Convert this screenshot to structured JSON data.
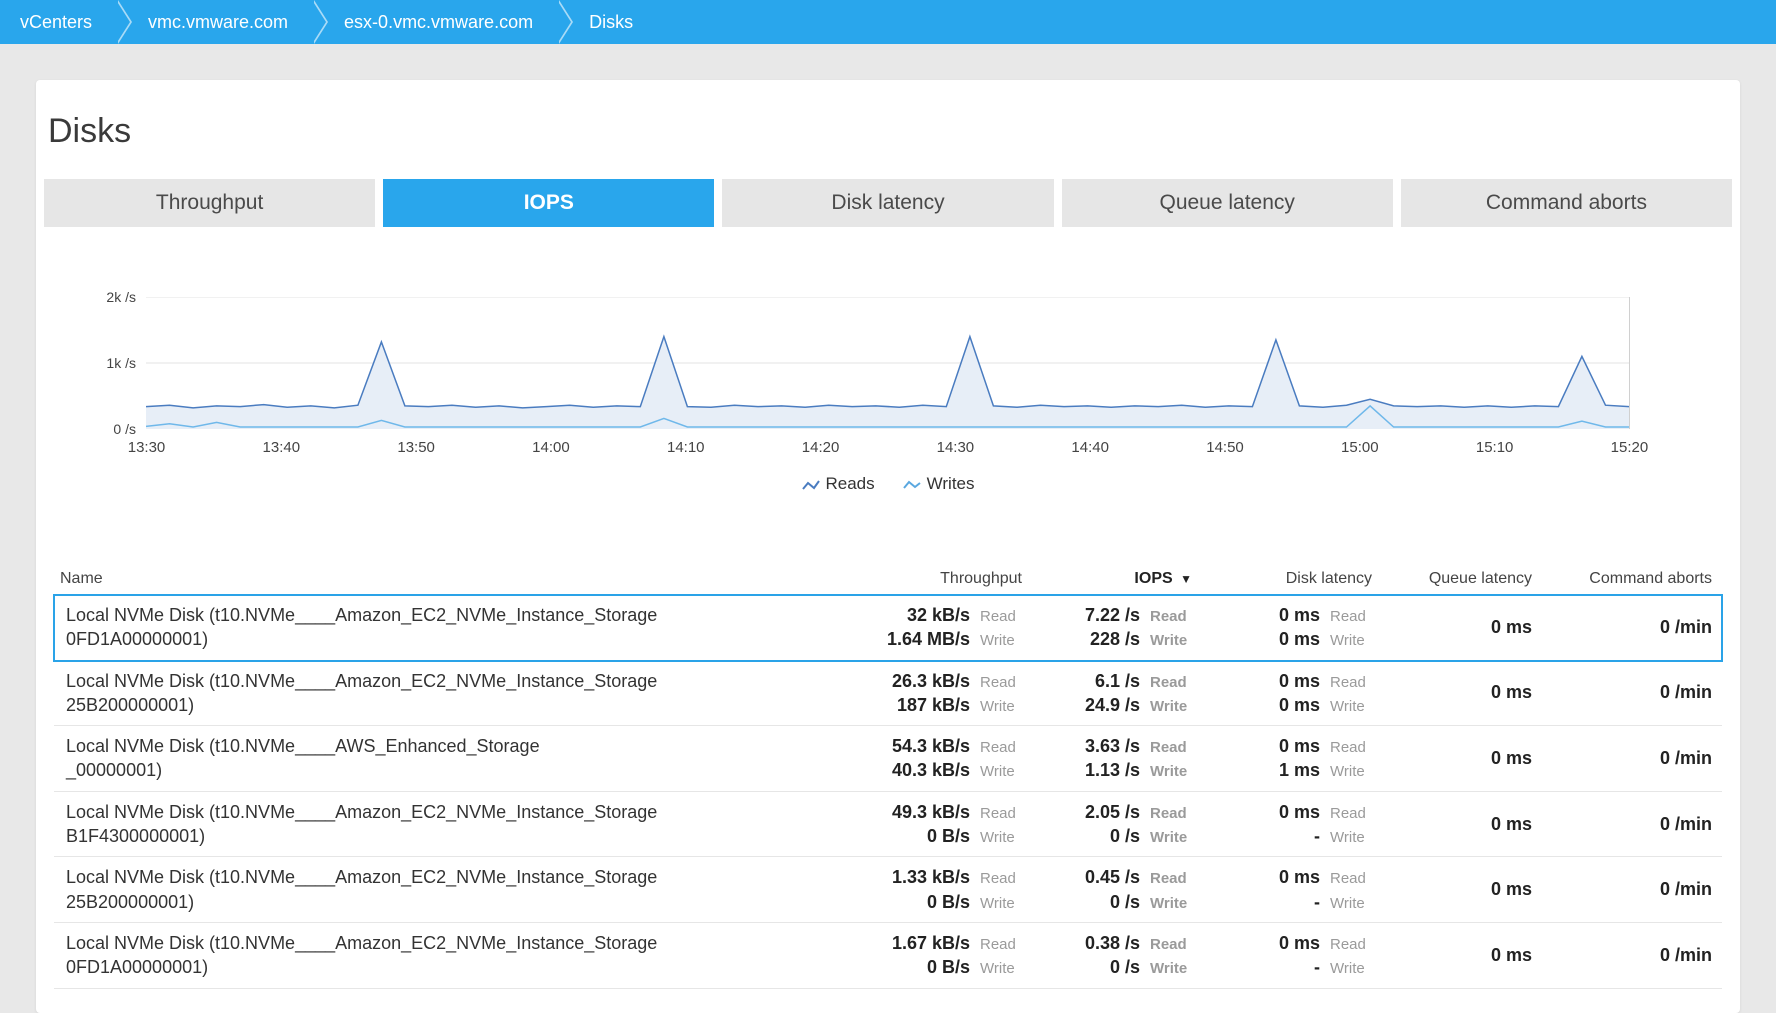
{
  "breadcrumb": [
    "vCenters",
    "vmc.vmware.com",
    "esx-0.vmc.vmware.com",
    "Disks"
  ],
  "page_title": "Disks",
  "tabs": [
    {
      "label": "Throughput",
      "active": false
    },
    {
      "label": "IOPS",
      "active": true
    },
    {
      "label": "Disk latency",
      "active": false
    },
    {
      "label": "Queue latency",
      "active": false
    },
    {
      "label": "Command aborts",
      "active": false
    }
  ],
  "legend": {
    "reads": "Reads",
    "writes": "Writes"
  },
  "chart_data": {
    "type": "area",
    "ylabel": "",
    "y_ticks": [
      "2k /s",
      "1k /s",
      "0 /s"
    ],
    "x_ticks": [
      "13:30",
      "13:40",
      "13:50",
      "14:00",
      "14:10",
      "14:20",
      "14:30",
      "14:40",
      "14:50",
      "15:00",
      "15:10",
      "15:20"
    ],
    "ylim": [
      0,
      2000
    ],
    "series": [
      {
        "name": "Reads",
        "x": [
          "13:22",
          "13:24",
          "13:26",
          "13:28",
          "13:30",
          "13:32",
          "13:34",
          "13:36",
          "13:38",
          "13:40",
          "13:42",
          "13:44",
          "13:46",
          "13:48",
          "13:50",
          "13:52",
          "13:54",
          "13:56",
          "13:58",
          "14:00",
          "14:02",
          "14:04",
          "14:05",
          "14:06",
          "14:08",
          "14:10",
          "14:12",
          "14:14",
          "14:16",
          "14:18",
          "14:20",
          "14:22",
          "14:24",
          "14:26",
          "14:28",
          "14:29",
          "14:30",
          "14:32",
          "14:34",
          "14:36",
          "14:38",
          "14:40",
          "14:42",
          "14:44",
          "14:46",
          "14:48",
          "14:50",
          "14:52",
          "14:53",
          "14:54",
          "14:56",
          "14:58",
          "15:00",
          "15:02",
          "15:04",
          "15:06",
          "15:08",
          "15:10",
          "15:12",
          "15:14",
          "15:15",
          "15:16",
          "15:18",
          "15:20"
        ],
        "values": [
          340,
          360,
          320,
          350,
          340,
          370,
          330,
          350,
          320,
          360,
          1320,
          350,
          340,
          360,
          330,
          350,
          320,
          340,
          360,
          330,
          350,
          340,
          1400,
          340,
          330,
          360,
          340,
          350,
          330,
          360,
          340,
          350,
          330,
          360,
          340,
          1400,
          350,
          330,
          360,
          340,
          350,
          330,
          350,
          340,
          360,
          330,
          350,
          340,
          1350,
          350,
          330,
          360,
          450,
          350,
          340,
          350,
          330,
          350,
          330,
          350,
          340,
          1100,
          360,
          340
        ]
      },
      {
        "name": "Writes",
        "x": [
          "13:22",
          "13:24",
          "13:26",
          "13:28",
          "13:30",
          "13:32",
          "13:34",
          "13:36",
          "13:38",
          "13:40",
          "13:42",
          "13:44",
          "13:46",
          "13:48",
          "13:50",
          "13:52",
          "13:54",
          "13:56",
          "13:58",
          "14:00",
          "14:02",
          "14:04",
          "14:05",
          "14:06",
          "14:08",
          "14:10",
          "14:12",
          "14:14",
          "14:16",
          "14:18",
          "14:20",
          "14:22",
          "14:24",
          "14:26",
          "14:28",
          "14:29",
          "14:30",
          "14:32",
          "14:34",
          "14:36",
          "14:38",
          "14:40",
          "14:42",
          "14:44",
          "14:46",
          "14:48",
          "14:50",
          "14:52",
          "14:53",
          "14:54",
          "14:56",
          "14:58",
          "15:00",
          "15:02",
          "15:04",
          "15:06",
          "15:08",
          "15:10",
          "15:12",
          "15:14",
          "15:15",
          "15:16",
          "15:18",
          "15:20"
        ],
        "values": [
          40,
          80,
          30,
          100,
          30,
          30,
          30,
          30,
          30,
          30,
          130,
          30,
          30,
          30,
          30,
          30,
          30,
          30,
          30,
          30,
          30,
          30,
          160,
          30,
          30,
          30,
          30,
          30,
          30,
          30,
          30,
          30,
          30,
          30,
          30,
          30,
          30,
          30,
          30,
          30,
          30,
          30,
          30,
          30,
          30,
          30,
          30,
          30,
          30,
          30,
          30,
          30,
          350,
          30,
          30,
          30,
          30,
          30,
          30,
          30,
          30,
          120,
          30,
          30
        ]
      }
    ]
  },
  "table": {
    "sort_col": "IOPS",
    "sort_dir_glyph": "▼",
    "headers": {
      "name": "Name",
      "throughput": "Throughput",
      "iops": "IOPS",
      "disk_latency": "Disk latency",
      "queue_latency": "Queue latency",
      "command_aborts": "Command aborts"
    },
    "read_lbl": "Read",
    "write_lbl": "Write",
    "rows": [
      {
        "sel": true,
        "name_l1": "Local NVMe Disk (t10.NVMe____Amazon_EC2_NVMe_Instance_Storage",
        "name_l2": "0FD1A00000001)",
        "tp_r": "32 kB/s",
        "tp_w": "1.64 MB/s",
        "io_r": "7.22 /s",
        "io_w": "228 /s",
        "dl_r": "0 ms",
        "dl_w": "0 ms",
        "ql": "0 ms",
        "ca": "0 /min"
      },
      {
        "sel": false,
        "name_l1": "Local NVMe Disk (t10.NVMe____Amazon_EC2_NVMe_Instance_Storage",
        "name_l2": "25B200000001)",
        "tp_r": "26.3 kB/s",
        "tp_w": "187 kB/s",
        "io_r": "6.1 /s",
        "io_w": "24.9 /s",
        "dl_r": "0 ms",
        "dl_w": "0 ms",
        "ql": "0 ms",
        "ca": "0 /min"
      },
      {
        "sel": false,
        "name_l1": "Local NVMe Disk (t10.NVMe____AWS_Enhanced_Storage",
        "name_l2": "_00000001)",
        "tp_r": "54.3 kB/s",
        "tp_w": "40.3 kB/s",
        "io_r": "3.63 /s",
        "io_w": "1.13 /s",
        "dl_r": "0 ms",
        "dl_w": "1 ms",
        "ql": "0 ms",
        "ca": "0 /min"
      },
      {
        "sel": false,
        "name_l1": "Local NVMe Disk (t10.NVMe____Amazon_EC2_NVMe_Instance_Storage",
        "name_l2": "B1F4300000001)",
        "tp_r": "49.3 kB/s",
        "tp_w": "0 B/s",
        "io_r": "2.05 /s",
        "io_w": "0 /s",
        "dl_r": "0 ms",
        "dl_w": "-",
        "ql": "0 ms",
        "ca": "0 /min"
      },
      {
        "sel": false,
        "name_l1": "Local NVMe Disk (t10.NVMe____Amazon_EC2_NVMe_Instance_Storage",
        "name_l2": "25B200000001)",
        "tp_r": "1.33 kB/s",
        "tp_w": "0 B/s",
        "io_r": "0.45 /s",
        "io_w": "0 /s",
        "dl_r": "0 ms",
        "dl_w": "-",
        "ql": "0 ms",
        "ca": "0 /min"
      },
      {
        "sel": false,
        "name_l1": "Local NVMe Disk (t10.NVMe____Amazon_EC2_NVMe_Instance_Storage",
        "name_l2": "0FD1A00000001)",
        "tp_r": "1.67 kB/s",
        "tp_w": "0 B/s",
        "io_r": "0.38 /s",
        "io_w": "0 /s",
        "dl_r": "0 ms",
        "dl_w": "-",
        "ql": "0 ms",
        "ca": "0 /min"
      }
    ]
  }
}
